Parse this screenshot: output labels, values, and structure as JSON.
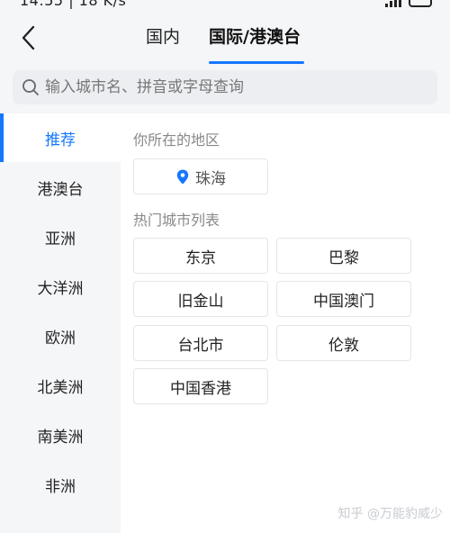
{
  "status_bar": {
    "time": "14:55 | 18 K/s"
  },
  "nav": {
    "tabs": [
      {
        "label": "国内",
        "active": false
      },
      {
        "label": "国际/港澳台",
        "active": true
      }
    ],
    "accent_color": "#1677ff"
  },
  "search": {
    "placeholder": "输入城市名、拼音或字母查询",
    "value": ""
  },
  "sidebar": {
    "items": [
      {
        "label": "推荐",
        "active": true
      },
      {
        "label": "港澳台",
        "active": false
      },
      {
        "label": "亚洲",
        "active": false
      },
      {
        "label": "大洋洲",
        "active": false
      },
      {
        "label": "欧洲",
        "active": false
      },
      {
        "label": "北美洲",
        "active": false
      },
      {
        "label": "南美洲",
        "active": false
      },
      {
        "label": "非洲",
        "active": false
      }
    ]
  },
  "content": {
    "location_section_title": "你所在的地区",
    "current_location": "珠海",
    "hot_section_title": "热门城市列表",
    "hot_cities": [
      "东京",
      "巴黎",
      "旧金山",
      "中国澳门",
      "台北市",
      "伦敦",
      "中国香港"
    ]
  },
  "watermark": "知乎 @万能豹威少",
  "icons": {
    "back": "chevron-left-icon",
    "search": "search-icon",
    "location": "location-pin-icon"
  }
}
